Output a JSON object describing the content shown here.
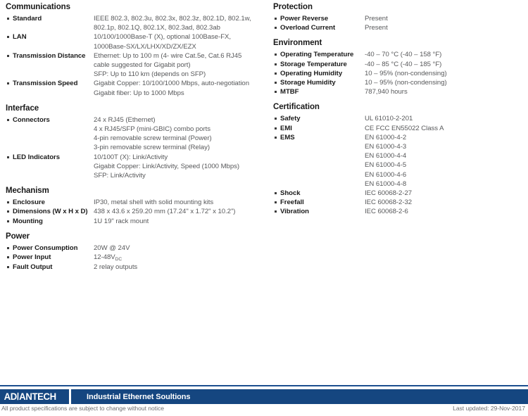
{
  "left_column": [
    {
      "title": "Communications",
      "rows": [
        {
          "label": "Standard",
          "value": "IEEE 802.3, 802.3u, 802.3x, 802.3z, 802.1D, 802.1w,\n802.1p, 802.1Q, 802.1X, 802.3ad, 802.3ab"
        },
        {
          "label": "LAN",
          "value": "10/100/1000Base-T (X), optional 100Base-FX,\n1000Base-SX/LX/LHX/XD/ZX/EZX"
        },
        {
          "label": "Transmission Distance",
          "value": "Ethernet: Up to 100 m (4- wire Cat.5e, Cat.6 RJ45\ncable suggested for Gigabit port)\nSFP: Up to 110 km (depends on SFP)"
        },
        {
          "label": "Transmission Speed",
          "value": "Gigabit Copper: 10/100/1000 Mbps, auto-negotiation\nGigabit fiber: Up to 1000 Mbps"
        }
      ]
    },
    {
      "title": "Interface",
      "rows": [
        {
          "label": "Connectors",
          "value": "24 x RJ45 (Ethernet)\n4 x RJ45/SFP (mini-GBIC) combo ports\n4-pin removable screw terminal (Power)\n3-pin removable screw terminal (Relay)"
        },
        {
          "label": "LED Indicators",
          "value": "10/100T (X): Link/Activity\nGigabit Copper: Link/Activity, Speed (1000 Mbps)\nSFP: Link/Activity"
        }
      ]
    },
    {
      "title": "Mechanism",
      "rows": [
        {
          "label": "Enclosure",
          "value": "IP30, metal shell with solid mounting kits"
        },
        {
          "label": "Dimensions (W x H x D)",
          "value": "438 x 43.6 x 259.20 mm (17.24\" x 1.72\" x 10.2\")"
        },
        {
          "label": "Mounting",
          "value": "1U 19\" rack mount"
        }
      ]
    },
    {
      "title": "Power",
      "rows": [
        {
          "label": "Power Consumption",
          "value": "20W @ 24V"
        },
        {
          "label": "Power Input",
          "value": "12-48V",
          "subscript": "DC"
        },
        {
          "label": "Fault Output",
          "value": "2 relay outputs"
        }
      ]
    }
  ],
  "right_column": [
    {
      "title": "Protection",
      "rows": [
        {
          "label": "Power Reverse",
          "value": "Present"
        },
        {
          "label": "Overload Current",
          "value": "Present"
        }
      ]
    },
    {
      "title": "Environment",
      "rows": [
        {
          "label": "Operating Temperature",
          "value": "-40 – 70 °C (-40 – 158 °F)"
        },
        {
          "label": "Storage Temperature",
          "value": "-40 – 85 °C (-40 – 185 °F)"
        },
        {
          "label": "Operating Humidity",
          "value": "10 – 95% (non-condensing)"
        },
        {
          "label": "Storage Humidity",
          "value": "10 – 95% (non-condensing)"
        },
        {
          "label": "MTBF",
          "value": "787,940 hours"
        }
      ]
    },
    {
      "title": "Certification",
      "rows": [
        {
          "label": "Safety",
          "value": "UL 61010-2-201"
        },
        {
          "label": "EMI",
          "value": "CE FCC EN55022 Class A"
        },
        {
          "label": "EMS",
          "value": "EN 61000-4-2\nEN 61000-4-3\nEN 61000-4-4\nEN 61000-4-5\nEN 61000-4-6\nEN 61000-4-8"
        },
        {
          "label": "Shock",
          "value": "IEC 60068-2-27"
        },
        {
          "label": "Freefall",
          "value": "IEC 60068-2-32"
        },
        {
          "label": "Vibration",
          "value": "IEC 60068-2-6"
        }
      ]
    }
  ],
  "footer": {
    "logo_part1": "AD",
    "logo_slash": "\\",
    "logo_part2": "ANTECH",
    "tagline": "Industrial Ethernet Soultions",
    "disclaimer": "All product specifications are subject to change without notice",
    "updated": "Last updated: 29-Nov-2017",
    "bar_color": "#154680",
    "rule_color": "#1c4f8f"
  }
}
